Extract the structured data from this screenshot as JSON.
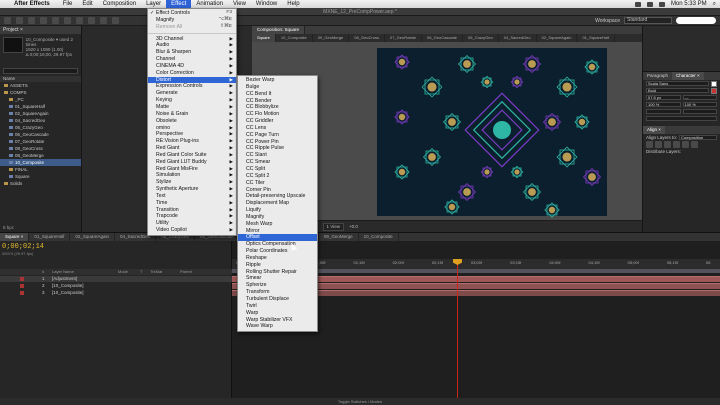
{
  "menubar": {
    "app_name": "After Effects",
    "items": [
      "File",
      "Edit",
      "Composition",
      "Layer",
      "Effect",
      "Animation",
      "View",
      "Window",
      "Help"
    ],
    "active_item": "Effect",
    "clock": "Mon 5:33 PM"
  },
  "window": {
    "title": "MXNE_12_PreCompPower.aep *"
  },
  "toolbar": {
    "workspace_label": "Workspace",
    "workspace_value": "Standard"
  },
  "project": {
    "tab": "Project ×",
    "selected_comp": "10_Composite",
    "meta": [
      "10_Composite ▾ used 2 times",
      "1920 x 1080 (1.00)",
      "Δ 0;00;16;00, 29.97 fps"
    ],
    "column_header": "Name",
    "rows": [
      {
        "label": "ASSETS",
        "type": "folder",
        "indent": false,
        "selected": false
      },
      {
        "label": "COMPS",
        "type": "folder",
        "indent": false,
        "selected": false
      },
      {
        "label": "_PC",
        "type": "folder",
        "indent": true,
        "selected": false
      },
      {
        "label": "01_SquareHalf",
        "type": "comp",
        "indent": true,
        "selected": false
      },
      {
        "label": "02_SquareAgain",
        "type": "comp",
        "indent": true,
        "selected": false
      },
      {
        "label": "04_SacredGeo",
        "type": "comp",
        "indent": true,
        "selected": false
      },
      {
        "label": "05_CrazyGeo",
        "type": "comp",
        "indent": true,
        "selected": false
      },
      {
        "label": "06_GeoCascade",
        "type": "comp",
        "indent": true,
        "selected": false
      },
      {
        "label": "07_GeoRotate",
        "type": "comp",
        "indent": true,
        "selected": false
      },
      {
        "label": "08_GeoCross",
        "type": "comp",
        "indent": true,
        "selected": false
      },
      {
        "label": "08_GeoMerge",
        "type": "comp",
        "indent": true,
        "selected": false
      },
      {
        "label": "10_Composite",
        "type": "comp",
        "indent": true,
        "selected": true
      },
      {
        "label": "FINAL",
        "type": "folder",
        "indent": true,
        "selected": false
      },
      {
        "label": "Square",
        "type": "comp",
        "indent": true,
        "selected": false
      },
      {
        "label": "Solids",
        "type": "folder",
        "indent": false,
        "selected": false
      }
    ],
    "footer": "8 bpc"
  },
  "effect_menu": {
    "items": [
      {
        "label": "Effect Controls",
        "shortcut": "F3",
        "checked": true,
        "submenu": false,
        "dim": false,
        "sep_after": false
      },
      {
        "label": "Magnify",
        "shortcut": "⌥⌘E",
        "checked": false,
        "submenu": false,
        "dim": false,
        "sep_after": false
      },
      {
        "label": "Remove All",
        "shortcut": "⇧⌘E",
        "checked": false,
        "submenu": false,
        "dim": true,
        "sep_after": true
      },
      {
        "label": "3D Channel",
        "submenu": true
      },
      {
        "label": "Audio",
        "submenu": true
      },
      {
        "label": "Blur & Sharpen",
        "submenu": true
      },
      {
        "label": "Channel",
        "submenu": true
      },
      {
        "label": "CINEMA 4D",
        "submenu": true
      },
      {
        "label": "Color Correction",
        "submenu": true
      },
      {
        "label": "Distort",
        "submenu": true,
        "highlight": true
      },
      {
        "label": "Expression Controls",
        "submenu": true
      },
      {
        "label": "Generate",
        "submenu": true
      },
      {
        "label": "Keying",
        "submenu": true
      },
      {
        "label": "Matte",
        "submenu": true
      },
      {
        "label": "Noise & Grain",
        "submenu": true
      },
      {
        "label": "Obsolete",
        "submenu": true
      },
      {
        "label": "omino",
        "submenu": true
      },
      {
        "label": "Perspective",
        "submenu": true
      },
      {
        "label": "RE:Vision Plug-ins",
        "submenu": true
      },
      {
        "label": "Red Giant",
        "submenu": true
      },
      {
        "label": "Red Giant Color Suite",
        "submenu": true
      },
      {
        "label": "Red Giant LUT Buddy",
        "submenu": true
      },
      {
        "label": "Red Giant MisFire",
        "submenu": true
      },
      {
        "label": "Simulation",
        "submenu": true
      },
      {
        "label": "Stylize",
        "submenu": true
      },
      {
        "label": "Synthetic Aperture",
        "submenu": true
      },
      {
        "label": "Text",
        "submenu": true
      },
      {
        "label": "Time",
        "submenu": true
      },
      {
        "label": "Transition",
        "submenu": true
      },
      {
        "label": "Trapcode",
        "submenu": true
      },
      {
        "label": "Utility",
        "submenu": true
      },
      {
        "label": "Video Copilot",
        "submenu": true
      }
    ]
  },
  "distort_menu": {
    "items": [
      "Bezier Warp",
      "Bulge",
      "CC Bend It",
      "CC Bender",
      "CC Blobbylize",
      "CC Flo Motion",
      "CC Griddler",
      "CC Lens",
      "CC Page Turn",
      "CC Power Pin",
      "CC Ripple Pulse",
      "CC Slant",
      "CC Smear",
      "CC Split",
      "CC Split 2",
      "CC Tiler",
      "Corner Pin",
      "Detail-preserving Upscale",
      "Displacement Map",
      "Liquify",
      "Magnify",
      "Mesh Warp",
      "Mirror",
      "Offset",
      "Optics Compensation",
      "Polar Coordinates",
      "Reshape",
      "Ripple",
      "Rolling Shutter Repair",
      "Smear",
      "Spherize",
      "Transform",
      "Turbulent Displace",
      "Twirl",
      "Warp",
      "Warp Stabilizer VFX",
      "Wave Warp"
    ],
    "highlighted": "Offset"
  },
  "comp_viewer": {
    "tab": "Composition: Square",
    "subtabs": [
      "Square",
      "10_Composite",
      "09_GeoMerge",
      "08_GeoCross",
      "07_GeoRotate",
      "06_GeoCascade",
      "05_CrazyGeo",
      "04_SacredGeo",
      "02_SquareAgain",
      "01_SquareHalf"
    ],
    "bottom": {
      "zoom": "(Half)",
      "camera": "Active Camera",
      "view": "1 View",
      "exposure": "+0.0"
    },
    "colors": {
      "bg": "#0b1f2e",
      "teal": "#2fb7a5",
      "purple": "#7a3cc2",
      "gold": "#d8b25a"
    }
  },
  "right_panel": {
    "top_tabs": [
      "Paragraph",
      "Character ×"
    ],
    "font": "Scala Sans",
    "style": "Bold",
    "size_values": [
      "57.5 px",
      "—",
      "100 %",
      "100 %"
    ],
    "align_tab": "Align ×",
    "align_label": "Align Layers to:",
    "align_value": "Composition",
    "distribute_label": "Distribute Layers:"
  },
  "timeline": {
    "tabs": [
      "Square ×",
      "01_SquareHalf",
      "02_SquareAgain",
      "04_SacredGeo",
      "05_CrazyGeo",
      "06_GeoCascade",
      "07_GeoRotate",
      "08_GeoCross",
      "09_GeoMerge",
      "10_Composite"
    ],
    "timecode": "0;00;02;14",
    "fps": "00074 (29.97 fps)",
    "column_header": [
      "#",
      "Layer Name",
      "Mode",
      "T",
      "TrkMat",
      "Parent"
    ],
    "layers": [
      {
        "num": "1",
        "name": "[Adjustment]",
        "selected": true
      },
      {
        "num": "2",
        "name": "[10_Composite]",
        "selected": false
      },
      {
        "num": "3",
        "name": "[10_Composite]",
        "selected": false
      }
    ],
    "ruler": [
      "0;00s",
      "00;15f",
      "01;00f",
      "01;15f",
      "02;00f",
      "02;15f",
      "03;00f",
      "03;15f",
      "04;00f",
      "04;15f",
      "05;00f",
      "05;15f",
      "06"
    ],
    "footer": "Toggle Switches / Modes"
  }
}
